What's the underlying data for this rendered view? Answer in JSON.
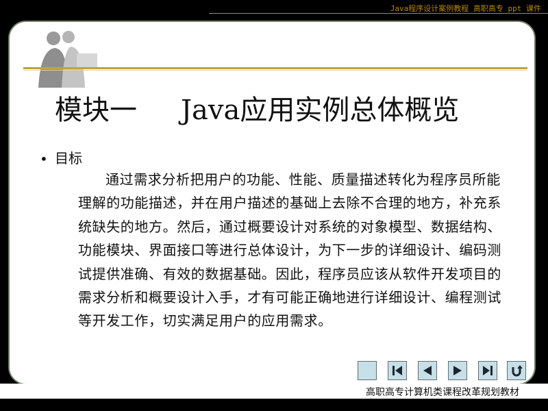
{
  "header": {
    "course_text": "Java程序设计案例教程 高职高专 ppt 课件"
  },
  "slide": {
    "title_left": "模块一",
    "title_right": "Java应用实例总体概览",
    "bullet_label": "目标",
    "paragraph": "通过需求分析把用户的功能、性能、质量描述转化为程序员所能理解的功能描述，并在用户描述的基础上去除不合理的地方，补充系统缺失的地方。然后，通过概要设计对系统的对象模型、数据结构、功能模块、界面接口等进行总体设计，为下一步的详细设计、编码测试提供准确、有效的数据基础。因此，程序员应该从软件开发项目的需求分析和概要设计入手，才有可能正确地进行详细设计、编程测试等开发工作，切实满足用户的应用需求。"
  },
  "nav_buttons": [
    {
      "name": "home-icon"
    },
    {
      "name": "first-icon"
    },
    {
      "name": "previous-icon"
    },
    {
      "name": "next-icon"
    },
    {
      "name": "last-icon"
    },
    {
      "name": "return-icon"
    }
  ],
  "footer": {
    "text": "高职高专计算机类课程改革规划教材"
  },
  "colors": {
    "gold_rule": "#c2a33a",
    "border": "#6f7f6a",
    "nav_button_fill": "#c7dfe7"
  }
}
